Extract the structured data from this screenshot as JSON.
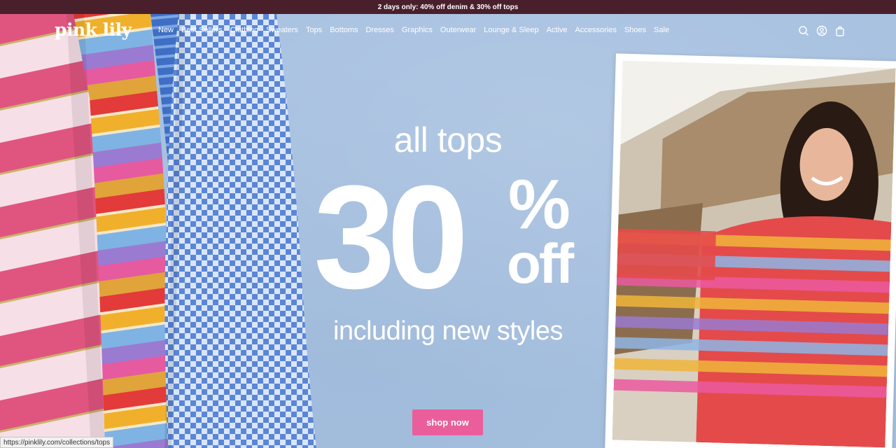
{
  "announcement": "2 days only: 40% off denim & 30% off tops",
  "brand": {
    "logo_text": "pink lily"
  },
  "nav": {
    "items": [
      "New",
      "Best Sellers",
      "Clothing",
      "Sweaters",
      "Tops",
      "Bottoms",
      "Dresses",
      "Graphics",
      "Outerwear",
      "Lounge & Sleep",
      "Active",
      "Accessories",
      "Shoes",
      "Sale"
    ]
  },
  "header_icons": [
    "search-icon",
    "account-icon",
    "bag-icon"
  ],
  "hero": {
    "line1": "all tops",
    "big_number": "30",
    "percent": "%",
    "off": "off",
    "subline": "including new styles",
    "cta": "shop now"
  },
  "status_url": "https://pinklily.com/collections/tops",
  "colors": {
    "announcement_bg": "#4a1f2c",
    "hero_bg": "#a7c1e0",
    "cta_bg": "#ea5f9b",
    "text": "#ffffff"
  }
}
